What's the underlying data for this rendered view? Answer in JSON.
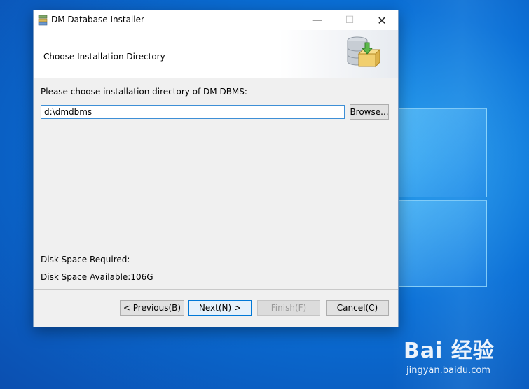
{
  "window": {
    "title": "DM Database Installer",
    "min_glyph": "—",
    "max_glyph": "☐",
    "close_glyph": "✕"
  },
  "header": {
    "title": "Choose Installation Directory",
    "icon": "database-install-icon"
  },
  "body": {
    "prompt": "Please choose installation directory of DM DBMS:",
    "path_value": "d:\\dmdbms",
    "browse_label": "Browse...",
    "disk_required": "Disk Space Required:",
    "disk_available": "Disk Space Available:106G"
  },
  "footer": {
    "previous_label": "< Previous(B)",
    "next_label": "Next(N) >",
    "finish_label": "Finish(F)",
    "cancel_label": "Cancel(C)"
  },
  "watermark": {
    "brand": "Bai 经验",
    "url": "jingyan.baidu.com"
  },
  "colors": {
    "desktop": "#0a6fd6",
    "accent": "#0078d7"
  }
}
